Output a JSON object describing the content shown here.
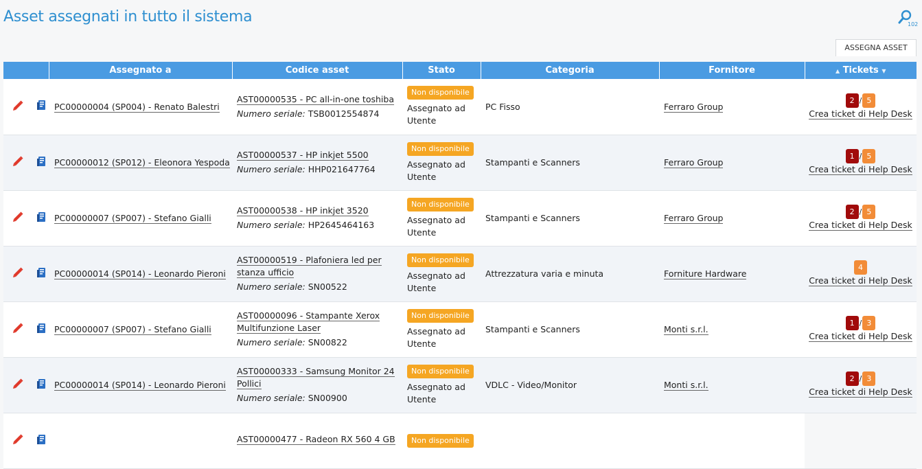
{
  "page": {
    "title": "Asset assegnati in tutto il sistema",
    "search_count": "102",
    "assign_button": "ASSEGNA ASSET"
  },
  "columns": {
    "assegnato": "Assegnato a",
    "codice": "Codice asset",
    "stato": "Stato",
    "categoria": "Categoria",
    "fornitore": "Fornitore",
    "tickets": "Tickets"
  },
  "rows": [
    {
      "assignee": "PC00000004 (SP004) - Renato Balestri",
      "asset": "AST00000535 - PC all-in-one toshiba",
      "serial_label": "Numero seriale:",
      "serial": "TSB0012554874",
      "status_badge": "Non disponibile",
      "status_text": "Assegnato ad Utente",
      "category": "PC Fisso",
      "supplier": "Ferraro Group",
      "t_open": "2",
      "slash": "/",
      "t_total": "5",
      "ticket_link": "Crea ticket di Help Desk"
    },
    {
      "assignee": "PC00000012 (SP012) - Eleonora Yespoda",
      "asset": "AST00000537 - HP inkjet 5500",
      "serial_label": "Numero seriale:",
      "serial": "HHP021647764",
      "status_badge": "Non disponibile",
      "status_text": "Assegnato ad Utente",
      "category": "Stampanti e Scanners",
      "supplier": "Ferraro Group",
      "t_open": "1",
      "slash": "/",
      "t_total": "5",
      "ticket_link": "Crea ticket di Help Desk"
    },
    {
      "assignee": "PC00000007 (SP007) - Stefano Gialli",
      "asset": "AST00000538 - HP inkjet 3520",
      "serial_label": "Numero seriale:",
      "serial": "HP2645464163",
      "status_badge": "Non disponibile",
      "status_text": "Assegnato ad Utente",
      "category": "Stampanti e Scanners",
      "supplier": "Ferraro Group",
      "t_open": "2",
      "slash": "/",
      "t_total": "5",
      "ticket_link": "Crea ticket di Help Desk"
    },
    {
      "assignee": "PC00000014 (SP014) - Leonardo Pieroni",
      "asset": "AST00000519 - Plafoniera led per stanza ufficio",
      "serial_label": "Numero seriale:",
      "serial": "SN00522",
      "status_badge": "Non disponibile",
      "status_text": "Assegnato ad Utente",
      "category": "Attrezzatura varia e minuta",
      "supplier": "Forniture Hardware",
      "t_open": "",
      "slash": "",
      "t_total": "4",
      "ticket_link": "Crea ticket di Help Desk"
    },
    {
      "assignee": "PC00000007 (SP007) - Stefano Gialli",
      "asset": "AST00000096 - Stampante Xerox Multifunzione Laser",
      "serial_label": "Numero seriale:",
      "serial": "SN00822",
      "status_badge": "Non disponibile",
      "status_text": "Assegnato ad Utente",
      "category": "Stampanti e Scanners",
      "supplier": "Monti s.r.l.",
      "t_open": "1",
      "slash": "/",
      "t_total": "3",
      "ticket_link": "Crea ticket di Help Desk"
    },
    {
      "assignee": "PC00000014 (SP014) - Leonardo Pieroni",
      "asset": "AST00000333 - Samsung Monitor 24 Pollici",
      "serial_label": "Numero seriale:",
      "serial": "SN00900",
      "status_badge": "Non disponibile",
      "status_text": "Assegnato ad Utente",
      "category": "VDLC - Video/Monitor",
      "supplier": "Monti s.r.l.",
      "t_open": "2",
      "slash": "/",
      "t_total": "3",
      "ticket_link": "Crea ticket di Help Desk"
    },
    {
      "assignee": "",
      "asset": "AST00000477 - Radeon RX 560 4 GB",
      "serial_label": "",
      "serial": "",
      "status_badge": "Non disponibile",
      "status_text": "",
      "category": "",
      "supplier": "",
      "t_open": "",
      "slash": "",
      "t_total": "",
      "ticket_link": ""
    }
  ]
}
